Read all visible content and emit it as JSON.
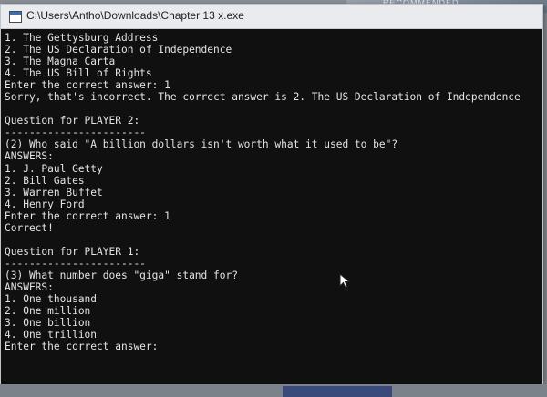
{
  "window": {
    "title": "C:\\Users\\Antho\\Downloads\\Chapter 13 x.exe",
    "icon": "console-app-icon"
  },
  "background": {
    "recommended_label": "RECOMMENDED"
  },
  "console": {
    "lines": [
      "1. The Gettysburg Address",
      "2. The US Declaration of Independence",
      "3. The Magna Carta",
      "4. The US Bill of Rights",
      "Enter the correct answer: 1",
      "Sorry, that's incorrect. The correct answer is 2. The US Declaration of Independence",
      "",
      "Question for PLAYER 2:",
      "-----------------------",
      "(2) Who said \"A billion dollars isn't worth what it used to be\"?",
      "ANSWERS:",
      "1. J. Paul Getty",
      "2. Bill Gates",
      "3. Warren Buffet",
      "4. Henry Ford",
      "Enter the correct answer: 1",
      "Correct!",
      "",
      "Question for PLAYER 1:",
      "-----------------------",
      "(3) What number does \"giga\" stand for?",
      "ANSWERS:",
      "1. One thousand",
      "2. One million",
      "3. One billion",
      "4. One trillion",
      "Enter the correct answer:"
    ]
  },
  "colors": {
    "console_bg": "#101010",
    "console_text": "#e4e4e4",
    "titlebar_bg": "#e9ebee"
  }
}
